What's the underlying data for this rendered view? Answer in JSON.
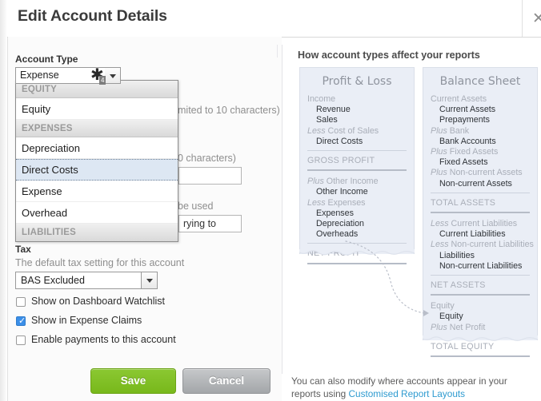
{
  "dialog": {
    "title": "Edit Account Details",
    "close_icon": "close-icon"
  },
  "form": {
    "account_type_label": "Account Type",
    "account_type_value": "Expense",
    "cursor_badge": "4",
    "code_hint": "mited to 10 characters)",
    "name_hint": "0 characters)",
    "desc_hint": "be used",
    "desc_value": "rying to",
    "tax_label": "Tax",
    "tax_hint": "The default tax setting for this account",
    "tax_value": "BAS Excluded",
    "checkboxes": [
      {
        "label": "Show on Dashboard Watchlist",
        "checked": false
      },
      {
        "label": "Show in Expense Claims",
        "checked": true
      },
      {
        "label": "Enable payments to this account",
        "checked": false
      }
    ]
  },
  "dropdown": {
    "groups": [
      {
        "title": "EQUITY",
        "items": [
          {
            "label": "Equity",
            "selected": false
          }
        ]
      },
      {
        "title": "EXPENSES",
        "items": [
          {
            "label": "Depreciation",
            "selected": false
          },
          {
            "label": "Direct Costs",
            "selected": true
          },
          {
            "label": "Expense",
            "selected": false
          },
          {
            "label": "Overhead",
            "selected": false
          }
        ]
      },
      {
        "title": "LIABILITIES",
        "items": []
      }
    ]
  },
  "buttons": {
    "save": "Save",
    "cancel": "Cancel"
  },
  "reports": {
    "heading": "How account types affect your reports",
    "profit_loss": {
      "title": "Profit & Loss",
      "rows": [
        {
          "kind": "head",
          "italic": "",
          "text": "Income"
        },
        {
          "kind": "item",
          "text": "Revenue"
        },
        {
          "kind": "item",
          "text": "Sales"
        },
        {
          "kind": "head",
          "italic": "Less ",
          "text": "Cost of Sales"
        },
        {
          "kind": "item",
          "text": "Direct Costs"
        },
        {
          "kind": "rule-thin"
        },
        {
          "kind": "total",
          "text": "GROSS PROFIT"
        },
        {
          "kind": "rule-thick"
        },
        {
          "kind": "gap"
        },
        {
          "kind": "head",
          "italic": "Plus ",
          "text": "Other Income"
        },
        {
          "kind": "item",
          "text": "Other Income"
        },
        {
          "kind": "head",
          "italic": "Less ",
          "text": "Expenses"
        },
        {
          "kind": "item",
          "text": "Expenses"
        },
        {
          "kind": "item",
          "text": "Depreciation"
        },
        {
          "kind": "item",
          "text": "Overheads"
        },
        {
          "kind": "rule-thin"
        },
        {
          "kind": "total",
          "text": "NET PROFIT"
        },
        {
          "kind": "rule-thick"
        }
      ]
    },
    "balance_sheet": {
      "title": "Balance Sheet",
      "rows": [
        {
          "kind": "head",
          "italic": "",
          "text": "Current Assets"
        },
        {
          "kind": "item",
          "text": "Current Assets"
        },
        {
          "kind": "item",
          "text": "Prepayments"
        },
        {
          "kind": "head",
          "italic": "Plus ",
          "text": "Bank"
        },
        {
          "kind": "item",
          "text": "Bank Accounts"
        },
        {
          "kind": "head",
          "italic": "Plus ",
          "text": "Fixed Assets"
        },
        {
          "kind": "item",
          "text": "Fixed Assets"
        },
        {
          "kind": "head",
          "italic": "Plus ",
          "text": "Non-current Assets"
        },
        {
          "kind": "item",
          "text": "Non-current Assets"
        },
        {
          "kind": "rule-thin"
        },
        {
          "kind": "total",
          "text": "TOTAL ASSETS"
        },
        {
          "kind": "rule-thick"
        },
        {
          "kind": "gap"
        },
        {
          "kind": "head",
          "italic": "Less ",
          "text": "Current Liabilities"
        },
        {
          "kind": "item",
          "text": "Current Liabilities"
        },
        {
          "kind": "head",
          "italic": "Less ",
          "text": "Non-current Liabilities"
        },
        {
          "kind": "item",
          "text": "Liabilities"
        },
        {
          "kind": "item",
          "text": "Non-current Liabilities"
        },
        {
          "kind": "rule-thin"
        },
        {
          "kind": "total",
          "text": "NET ASSETS"
        },
        {
          "kind": "rule-thick"
        },
        {
          "kind": "gap"
        },
        {
          "kind": "head",
          "italic": "",
          "text": "Equity"
        },
        {
          "kind": "item",
          "text": "Equity"
        },
        {
          "kind": "head",
          "italic": "Plus ",
          "text": "Net Profit"
        },
        {
          "kind": "rule-thin"
        },
        {
          "kind": "total",
          "text": "TOTAL EQUITY"
        },
        {
          "kind": "rule-thick"
        }
      ]
    }
  },
  "footer": {
    "note_text": "You can also modify where accounts appear in your reports using ",
    "note_link": "Customised Report Layouts"
  },
  "colors": {
    "save_green": "#7db81e",
    "cancel_grey": "#b0b3b6",
    "link_blue": "#2f9bd0",
    "checkbox_blue": "#3b8fe8",
    "paper_bg": "#eaeef6",
    "selected_row": "#dde7f3"
  }
}
